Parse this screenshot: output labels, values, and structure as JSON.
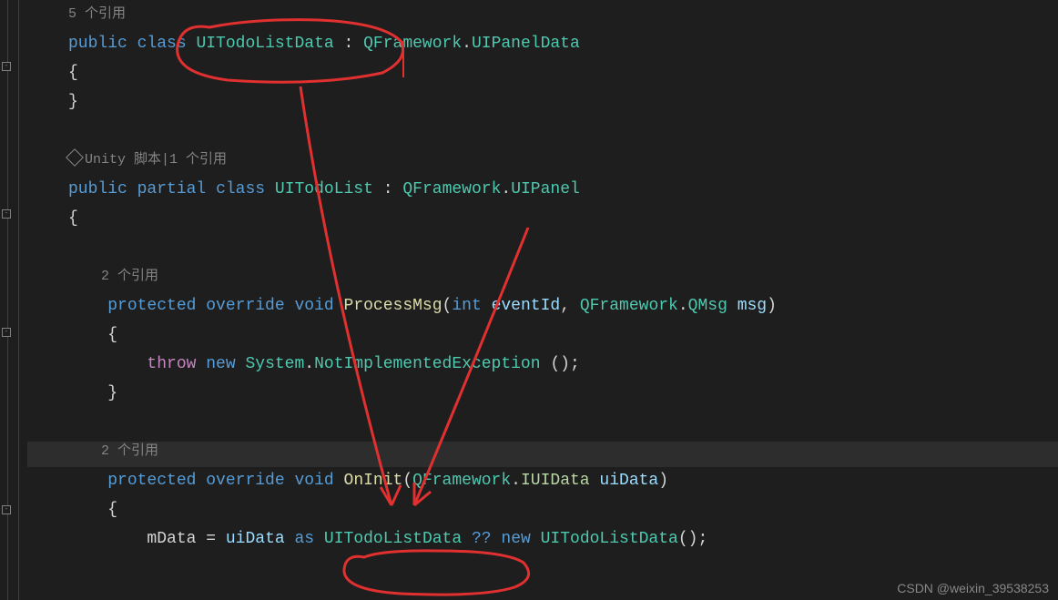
{
  "codelens": {
    "refs5": "5 个引用",
    "unity": "Unity 脚本",
    "refs1": "1 个引用",
    "refs2a": "2 个引用",
    "refs2b": "2 个引用"
  },
  "kw": {
    "public": "public",
    "class": "class",
    "partial": "partial",
    "protected": "protected",
    "override": "override",
    "void": "void",
    "int": "int",
    "throw": "throw",
    "new": "new",
    "as": "as"
  },
  "cls": {
    "UITodoListData": "UITodoListData",
    "UITodoList": "UITodoList",
    "UIPanelData": "UIPanelData",
    "UIPanel": "UIPanel",
    "QMsg": "QMsg",
    "IUIData": "IUIData",
    "NotImplementedException": "NotImplementedException"
  },
  "ns": {
    "QFramework": "QFramework",
    "System": "System"
  },
  "method": {
    "ProcessMsg": "ProcessMsg",
    "OnInit": "OnInit"
  },
  "param": {
    "eventId": "eventId",
    "msg": "msg",
    "uiData": "uiData"
  },
  "var": {
    "mData": "mData"
  },
  "op": {
    "nullcoalesce": "??",
    "assign": "=",
    "colon": ":",
    "dot": ".",
    "comma": ",",
    "semi": ";",
    "lparen": "(",
    "rparen": ")",
    "lbrace": "{",
    "rbrace": "}",
    "pipe": "|"
  },
  "watermark": "CSDN @weixin_39538253"
}
